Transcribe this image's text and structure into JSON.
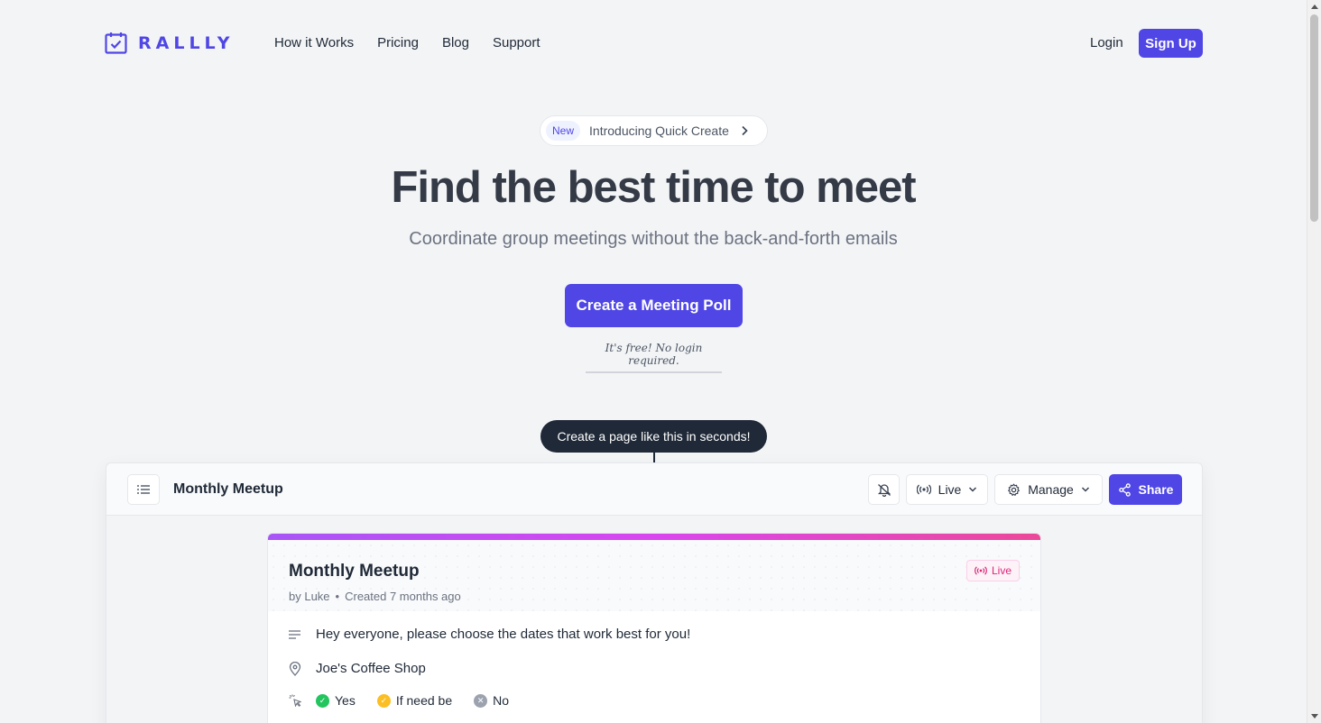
{
  "brand": {
    "name": "RALLLY",
    "color": "#4f46e5"
  },
  "nav": {
    "links": [
      "How it Works",
      "Pricing",
      "Blog",
      "Support"
    ],
    "login": "Login",
    "signup": "Sign Up"
  },
  "hero": {
    "pill_badge": "New",
    "pill_text": "Introducing Quick Create",
    "headline": "Find the best time to meet",
    "subhead": "Coordinate group meetings without the back-and-forth emails",
    "cta": "Create a Meeting Poll",
    "note": "It's free! No login required."
  },
  "tooltip": "Create a page like this in seconds!",
  "preview": {
    "title": "Monthly Meetup",
    "live_label": "Live",
    "manage_label": "Manage",
    "share_label": "Share",
    "card": {
      "title": "Monthly Meetup",
      "author": "by Luke",
      "created": "Created 7 months ago",
      "status": "Live",
      "description": "Hey everyone, please choose the dates that work best for you!",
      "location": "Joe's Coffee Shop",
      "legend": {
        "yes": "Yes",
        "maybe": "If need be",
        "no": "No"
      }
    }
  },
  "colors": {
    "accent": "#4f46e5",
    "yes": "#22c55e",
    "maybe": "#fbbf24",
    "no": "#9ca3af",
    "live": "#db2777"
  }
}
